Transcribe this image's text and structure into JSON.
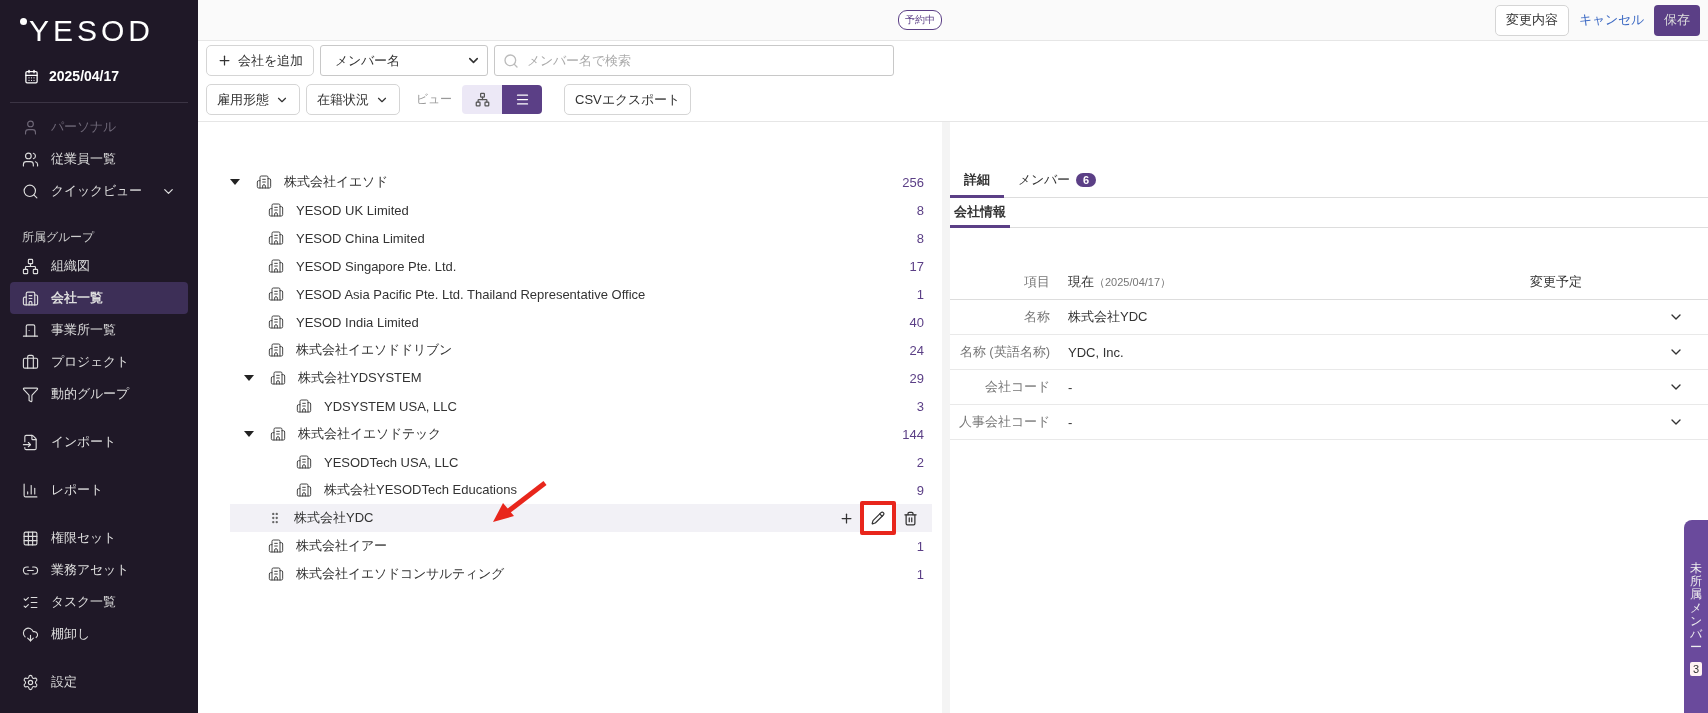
{
  "sidebar": {
    "logo": "YESOD",
    "date": "2025/04/17",
    "groups": [
      {
        "items": [
          {
            "label": "パーソナル",
            "disabled": true,
            "selected": false
          },
          {
            "label": "従業員一覧",
            "disabled": false,
            "selected": false
          },
          {
            "label": "クイックビュー",
            "disabled": false,
            "selected": false,
            "expandable": true
          }
        ]
      },
      {
        "heading": "所属グループ",
        "items": [
          {
            "label": "組織図",
            "disabled": false,
            "selected": false
          },
          {
            "label": "会社一覧",
            "disabled": false,
            "selected": true
          },
          {
            "label": "事業所一覧",
            "disabled": false,
            "selected": false
          },
          {
            "label": "プロジェクト",
            "disabled": false,
            "selected": false
          },
          {
            "label": "動的グループ",
            "disabled": false,
            "selected": false
          }
        ]
      },
      {
        "items": [
          {
            "label": "インポート",
            "disabled": false,
            "selected": false
          }
        ]
      },
      {
        "items": [
          {
            "label": "レポート",
            "disabled": false,
            "selected": false
          }
        ]
      },
      {
        "items": [
          {
            "label": "権限セット",
            "disabled": false,
            "selected": false
          },
          {
            "label": "業務アセット",
            "disabled": false,
            "selected": false
          },
          {
            "label": "タスク一覧",
            "disabled": false,
            "selected": false
          },
          {
            "label": "棚卸し",
            "disabled": false,
            "selected": false
          }
        ]
      },
      {
        "items": [
          {
            "label": "設定",
            "disabled": false,
            "selected": false
          }
        ]
      }
    ]
  },
  "topbar": {
    "status_badge": "予約中",
    "changes_button": "変更内容",
    "cancel_link": "キャンセル",
    "save_button": "保存"
  },
  "toolbar": {
    "add_button": "会社を追加",
    "search_by": {
      "value": "メンバー名"
    },
    "search": {
      "placeholder": "メンバー名で検索"
    },
    "filters": [
      "雇用形態",
      "在籍状況"
    ],
    "view_label": "ビュー",
    "views": [
      {
        "kind": "org",
        "selected": false
      },
      {
        "kind": "list",
        "selected": true
      }
    ],
    "export_button": "CSVエクスポート"
  },
  "tree": [
    {
      "name": "株式会社イエソド",
      "count": "256",
      "selected": false,
      "expanded": true,
      "children": [
        {
          "name": "YESOD UK Limited",
          "count": "8",
          "selected": false
        },
        {
          "name": "YESOD China Limited",
          "count": "8",
          "selected": false
        },
        {
          "name": "YESOD Singapore Pte. Ltd.",
          "count": "17",
          "selected": false
        },
        {
          "name": "YESOD Asia Pacific Pte. Ltd. Thailand Representative Office",
          "count": "1",
          "selected": false
        },
        {
          "name": "YESOD India Limited",
          "count": "40",
          "selected": false
        },
        {
          "name": "株式会社イエソドドリブン",
          "count": "24",
          "selected": false
        },
        {
          "name": "株式会社YDSYSTEM",
          "count": "29",
          "selected": false,
          "expanded": true,
          "children": [
            {
              "name": "YDSYSTEM USA, LLC",
              "count": "3",
              "selected": false
            }
          ]
        },
        {
          "name": "株式会社イエソドテック",
          "count": "144",
          "selected": false,
          "expanded": true,
          "children": [
            {
              "name": "YESODTech USA, LLC",
              "count": "2",
              "selected": false
            },
            {
              "name": "株式会社YESODTech Educations",
              "count": "9",
              "selected": false
            }
          ]
        },
        {
          "name": "株式会社YDC",
          "selected": true
        },
        {
          "name": "株式会社イアー",
          "count": "1",
          "selected": false
        },
        {
          "name": "株式会社イエソドコンサルティング",
          "count": "1",
          "selected": false
        }
      ]
    }
  ],
  "detail": {
    "tabs": [
      {
        "label": "詳細",
        "selected": true
      },
      {
        "label": "メンバー",
        "badge": "6",
        "selected": false
      }
    ],
    "subtabs": [
      {
        "label": "会社情報",
        "selected": true
      }
    ],
    "header": {
      "item": "項目",
      "current": "現在",
      "current_date": "（2025/04/17）",
      "planned": "変更予定"
    },
    "rows": [
      {
        "label": "名称",
        "value": "株式会社YDC"
      },
      {
        "label": "名称 (英語名称)",
        "value": "YDC, Inc."
      },
      {
        "label": "会社コード",
        "value": "-"
      },
      {
        "label": "人事会社コード",
        "value": "-"
      }
    ]
  },
  "side_tab": {
    "label": "未所属メンバー",
    "count": "3"
  }
}
